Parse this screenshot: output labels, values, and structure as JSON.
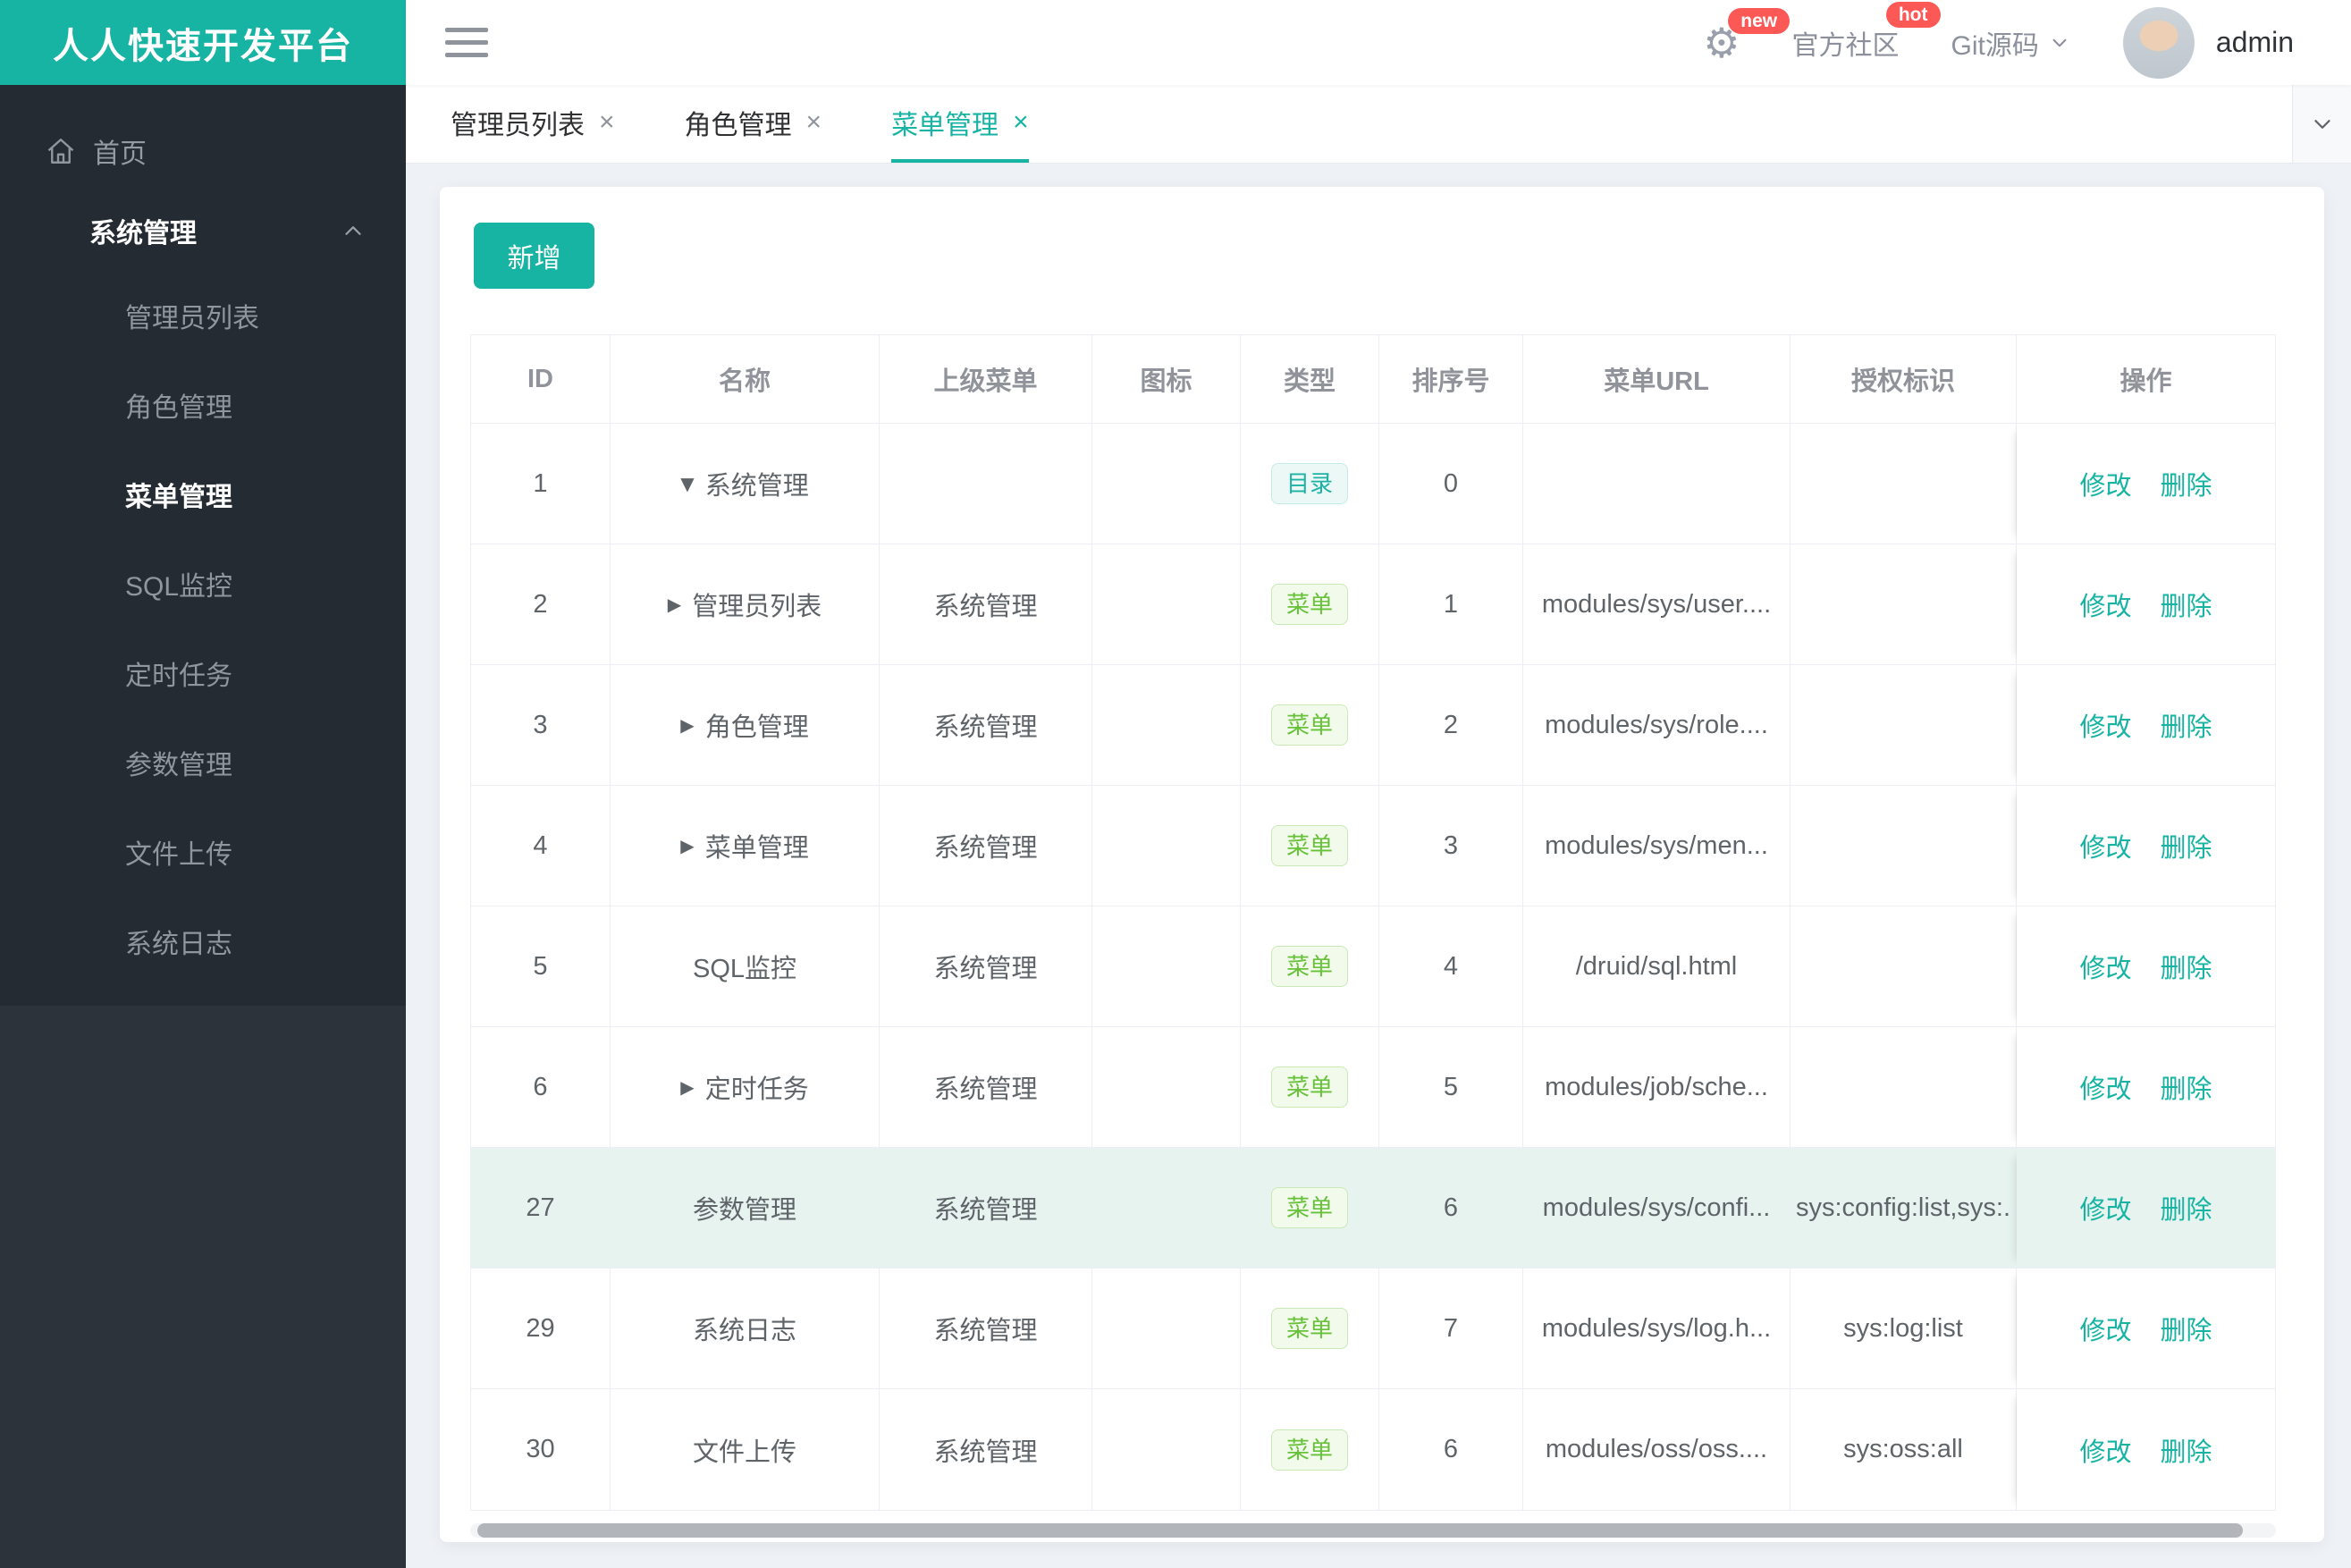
{
  "app": {
    "logo_title": "人人快速开发平台"
  },
  "topbar": {
    "settings_badge": "new",
    "community_label": "官方社区",
    "community_badge": "hot",
    "git_label": "Git源码",
    "username": "admin"
  },
  "tabbar": {
    "close_glyph": "×",
    "tabs": [
      {
        "label": "管理员列表",
        "active": false
      },
      {
        "label": "角色管理",
        "active": false
      },
      {
        "label": "菜单管理",
        "active": true
      }
    ]
  },
  "sidebar": {
    "home_label": "首页",
    "group_label": "系统管理",
    "items": [
      {
        "label": "管理员列表",
        "active": false
      },
      {
        "label": "角色管理",
        "active": false
      },
      {
        "label": "菜单管理",
        "active": true
      },
      {
        "label": "SQL监控",
        "active": false
      },
      {
        "label": "定时任务",
        "active": false
      },
      {
        "label": "参数管理",
        "active": false
      },
      {
        "label": "文件上传",
        "active": false
      },
      {
        "label": "系统日志",
        "active": false
      }
    ]
  },
  "toolbar": {
    "add_label": "新增"
  },
  "table": {
    "headers": [
      "ID",
      "名称",
      "上级菜单",
      "图标",
      "类型",
      "排序号",
      "菜单URL",
      "授权标识",
      "操作"
    ],
    "actions": {
      "edit": "修改",
      "delete": "删除"
    },
    "rows": [
      {
        "id": "1",
        "caret": "down",
        "name": "系统管理",
        "parent": "",
        "icon": "",
        "type": "目录",
        "type_kind": "dir",
        "order": "0",
        "url": "",
        "perm": "",
        "highlighted": false
      },
      {
        "id": "2",
        "caret": "right",
        "name": "管理员列表",
        "parent": "系统管理",
        "icon": "",
        "type": "菜单",
        "type_kind": "menu",
        "order": "1",
        "url": "modules/sys/user....",
        "perm": "",
        "highlighted": false
      },
      {
        "id": "3",
        "caret": "right",
        "name": "角色管理",
        "parent": "系统管理",
        "icon": "",
        "type": "菜单",
        "type_kind": "menu",
        "order": "2",
        "url": "modules/sys/role....",
        "perm": "",
        "highlighted": false
      },
      {
        "id": "4",
        "caret": "right",
        "name": "菜单管理",
        "parent": "系统管理",
        "icon": "",
        "type": "菜单",
        "type_kind": "menu",
        "order": "3",
        "url": "modules/sys/men...",
        "perm": "",
        "highlighted": false
      },
      {
        "id": "5",
        "caret": "none",
        "name": "SQL监控",
        "parent": "系统管理",
        "icon": "",
        "type": "菜单",
        "type_kind": "menu",
        "order": "4",
        "url": "/druid/sql.html",
        "perm": "",
        "highlighted": false
      },
      {
        "id": "6",
        "caret": "right",
        "name": "定时任务",
        "parent": "系统管理",
        "icon": "",
        "type": "菜单",
        "type_kind": "menu",
        "order": "5",
        "url": "modules/job/sche...",
        "perm": "",
        "highlighted": false
      },
      {
        "id": "27",
        "caret": "none",
        "name": "参数管理",
        "parent": "系统管理",
        "icon": "",
        "type": "菜单",
        "type_kind": "menu",
        "order": "6",
        "url": "modules/sys/confi...",
        "perm": "sys:config:list,sys:.",
        "highlighted": true
      },
      {
        "id": "29",
        "caret": "none",
        "name": "系统日志",
        "parent": "系统管理",
        "icon": "",
        "type": "菜单",
        "type_kind": "menu",
        "order": "7",
        "url": "modules/sys/log.h...",
        "perm": "sys:log:list",
        "highlighted": false
      },
      {
        "id": "30",
        "caret": "none",
        "name": "文件上传",
        "parent": "系统管理",
        "icon": "",
        "type": "菜单",
        "type_kind": "menu",
        "order": "6",
        "url": "modules/oss/oss....",
        "perm": "sys:oss:all",
        "highlighted": false
      }
    ]
  },
  "colors": {
    "accent_teal": "#17b3a3",
    "badge_red": "#fb5856",
    "tag_dir_teal": "#1cb2a6",
    "tag_menu_green": "#67c23a",
    "highlight_row": "#e6f3ef",
    "sidebar_dark": "#252b32"
  }
}
